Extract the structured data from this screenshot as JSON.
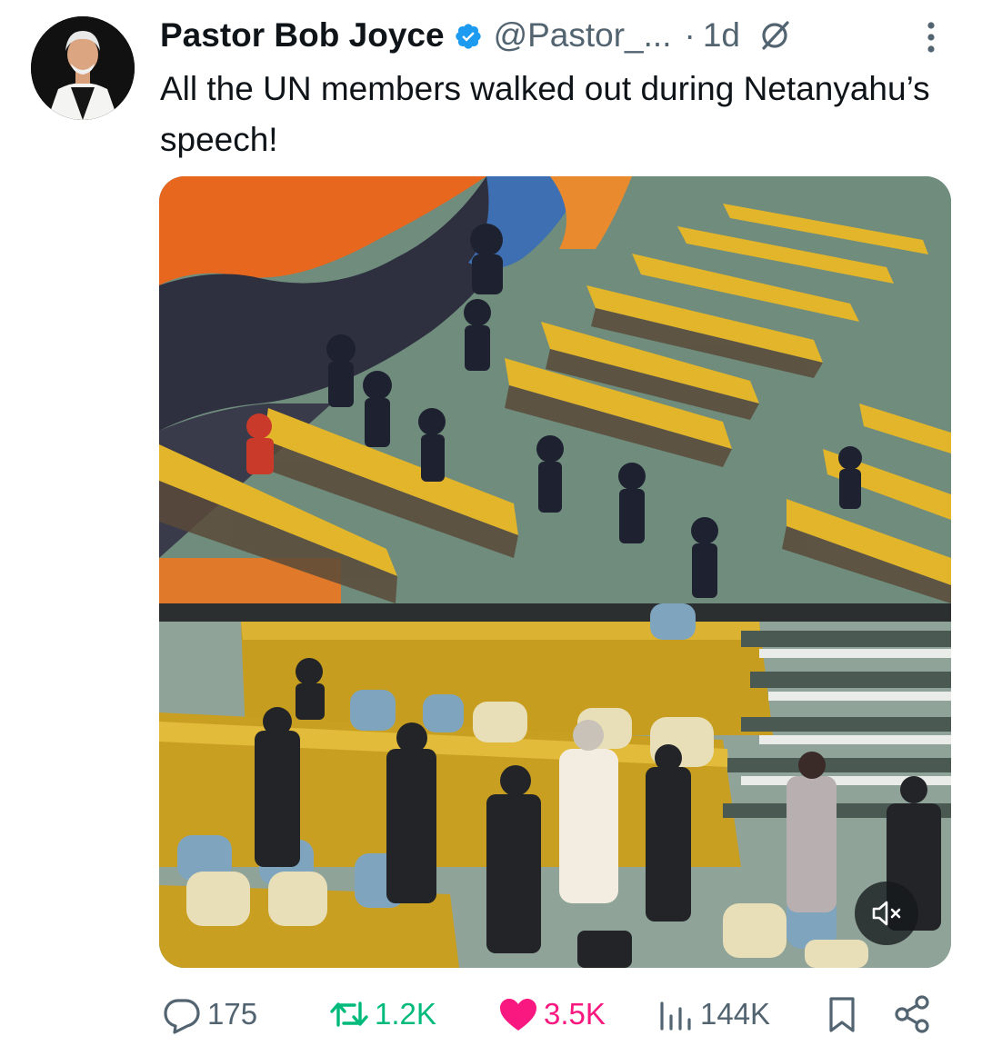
{
  "tweet": {
    "author_name": "Pastor Bob Joyce",
    "handle": "@Pastor_...",
    "separator": "·",
    "time": "1d",
    "text": "All the UN members walked out during Netanyahu’s speech!"
  },
  "media": {
    "type": "video",
    "muted": true
  },
  "stats": {
    "replies": "175",
    "reposts": "1.2K",
    "likes": "3.5K",
    "views": "144K"
  },
  "icons": {
    "verified": "verified-badge-icon",
    "no_edit": "slashed-circle-icon",
    "more": "more-vertical-icon",
    "reply": "reply-icon",
    "repost": "repost-icon",
    "like": "heart-icon",
    "views": "views-icon",
    "bookmark": "bookmark-icon",
    "share": "share-icon",
    "mute": "muted-speaker-icon"
  },
  "colors": {
    "verified": "#1d9bf0",
    "repost_active": "#00ba7c",
    "like_active": "#f91880",
    "muted_text": "#536471"
  }
}
